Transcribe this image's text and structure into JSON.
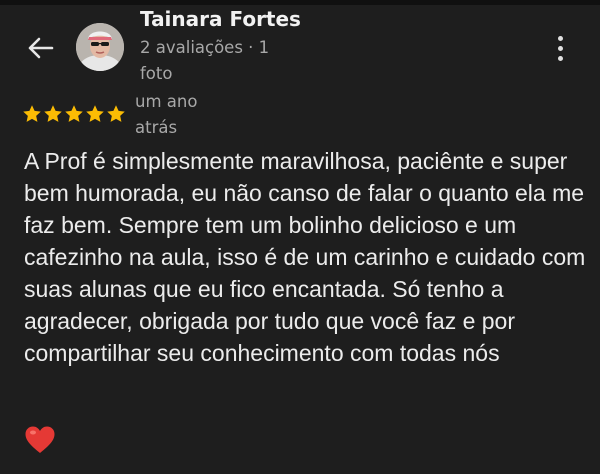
{
  "reviewer": {
    "name": "Tainara Fortes",
    "meta": "2 avaliações · 1 foto"
  },
  "review": {
    "rating": 5,
    "rating_max": 5,
    "date": "um ano atrás",
    "text": "A Prof é simplesmente maravilhosa, paciênte e super bem humorada, eu não canso de falar o quanto ela me faz bem. Sempre tem um bolinho delicioso e um cafezinho na aula, isso é de um carinho e cuidado com suas alunas que eu fico encantada. Só tenho a agradecer, obrigada por tudo que você faz e por compartilhar seu conhecimento com todas nós",
    "emoji": "heart"
  },
  "icons": {
    "back": "arrow-left-icon",
    "more": "more-vertical-icon",
    "star": "star-icon",
    "heart": "heart-icon"
  },
  "colors": {
    "background": "#1e1e1e",
    "star": "#fbbc04",
    "heart": "#e53935",
    "secondary_text": "#a8a8a8"
  }
}
